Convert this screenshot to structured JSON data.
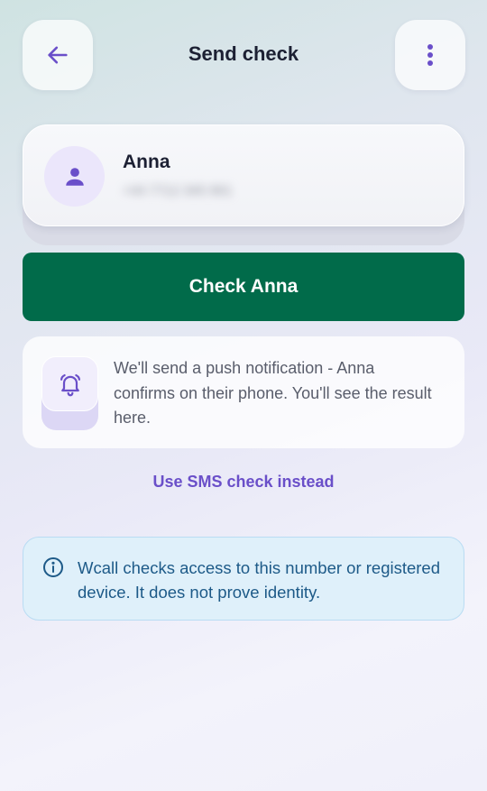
{
  "header": {
    "title": "Send check",
    "back_icon": "arrow-left-icon",
    "more_icon": "more-vertical-icon"
  },
  "contact": {
    "name": "Anna",
    "phone": "+44 7712 345 901",
    "phone_obscured": true,
    "avatar_icon": "person-icon"
  },
  "primary_button": {
    "label": "Check Anna"
  },
  "info": {
    "icon": "bell-ringing-icon",
    "text": "We'll send a push notification - Anna confirms on their phone. You'll see the result here."
  },
  "sms_link": {
    "label": "Use SMS check instead"
  },
  "notice": {
    "icon": "info-circle-icon",
    "text": "Wcall checks access to this number or registered device. It does not prove identity."
  },
  "colors": {
    "accent": "#6a4fc9",
    "primary_button": "#016b4a",
    "notice_background": "#dff0fa",
    "notice_text": "#1d5a88"
  }
}
